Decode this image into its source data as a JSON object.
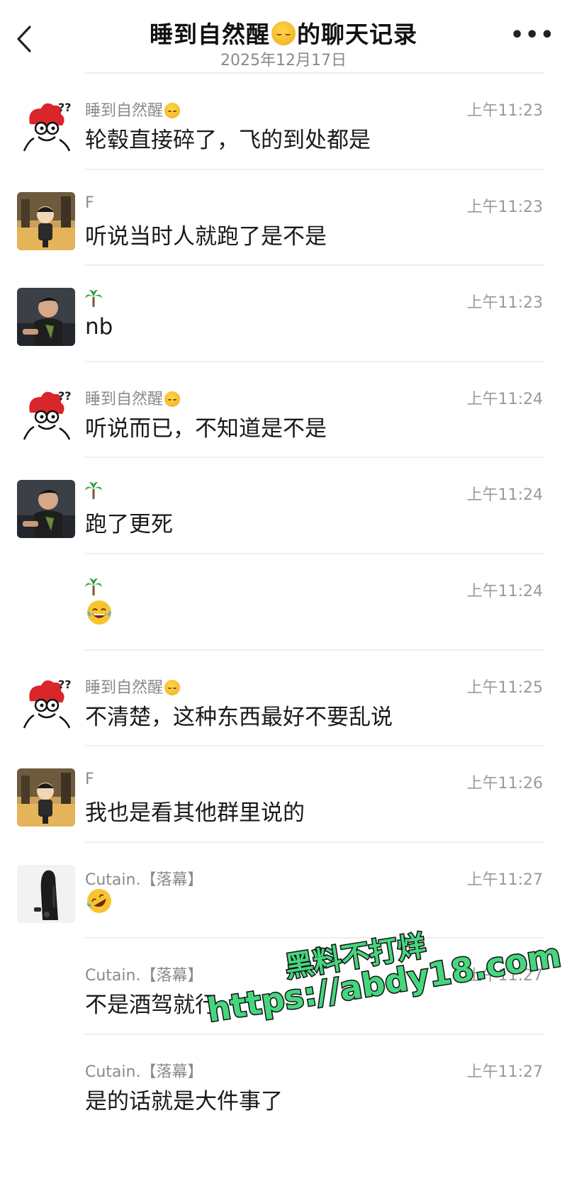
{
  "header": {
    "title_prefix": "睡到自然醒",
    "title_emoji": "sleeping-face-emoji",
    "title_suffix": "的聊天记录",
    "subtitle": "2025年12月17日",
    "back_icon": "chevron-left-icon",
    "more_icon": "more-dots-icon"
  },
  "messages": [
    {
      "sender": "睡到自然醒",
      "sender_emoji": "sleeping-face-emoji",
      "avatar": "rooster-cartoon-avatar",
      "time": "上午11:23",
      "text": "轮毂直接碎了，飞的到处都是"
    },
    {
      "sender": "F",
      "avatar": "cartoon-character-avatar",
      "time": "上午11:23",
      "text": "听说当时人就跑了是不是"
    },
    {
      "sender": "",
      "sender_emoji": "palm-tree-emoji",
      "avatar": "person-photo-avatar",
      "time": "上午11:23",
      "text": "nb"
    },
    {
      "sender": "睡到自然醒",
      "sender_emoji": "sleeping-face-emoji",
      "avatar": "rooster-cartoon-avatar",
      "time": "上午11:24",
      "text": "听说而已，不知道是不是"
    },
    {
      "sender": "",
      "sender_emoji": "palm-tree-emoji",
      "avatar": "person-photo-avatar",
      "time": "上午11:24",
      "text": "跑了更死"
    },
    {
      "sender": "",
      "sender_emoji": "palm-tree-emoji",
      "avatar": "",
      "time": "上午11:24",
      "text": "",
      "text_emoji": "laughing-tears-emoji"
    },
    {
      "sender": "睡到自然醒",
      "sender_emoji": "sleeping-face-emoji",
      "avatar": "rooster-cartoon-avatar",
      "time": "上午11:25",
      "text": "不清楚，这种东西最好不要乱说"
    },
    {
      "sender": "F",
      "avatar": "cartoon-character-avatar",
      "time": "上午11:26",
      "text": "我也是看其他群里说的"
    },
    {
      "sender": "Cutain.【落幕】",
      "avatar": "dark-figure-photo-avatar",
      "time": "上午11:27",
      "text": "",
      "text_emoji": "rolling-laughing-emoji"
    },
    {
      "sender": "Cutain.【落幕】",
      "avatar": "",
      "time": "上午11:27",
      "text": "不是酒驾就行"
    },
    {
      "sender": "Cutain.【落幕】",
      "avatar": "",
      "time": "上午11:27",
      "text": "是的话就是大件事了"
    }
  ],
  "watermark": {
    "line1": "黑料不打烊",
    "line2": "https://abdy18.com",
    "color": "#45d67e"
  }
}
